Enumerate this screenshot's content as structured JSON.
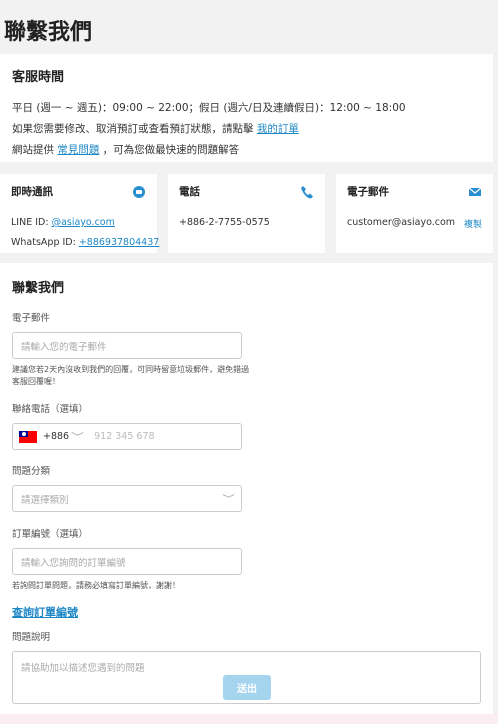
{
  "page_title": "聯繫我們",
  "service_hours": {
    "heading": "客服時間",
    "line1": "平日 (週一 ~ 週五)：09:00 ~ 22:00；假日 (週六/日及連續假日)：12:00 ~ 18:00",
    "line2_prefix": "如果您需要修改、取消預訂或查看預訂狀態，請點擊 ",
    "line2_link": "我的訂單",
    "line3_prefix": "網站提供 ",
    "line3_link": "常見問題",
    "line3_suffix": " ，可為您做最快速的問題解答"
  },
  "chat": {
    "heading": "即時通訊",
    "icon": "chat-icon",
    "line_label": "LINE ID: ",
    "line_value": "@asiayo.com",
    "whatsapp_label": "WhatsApp ID: ",
    "whatsapp_value": "+886937804437"
  },
  "phone": {
    "heading": "電話",
    "icon": "phone-icon",
    "value": "+886-2-7755-0575"
  },
  "email": {
    "heading": "電子郵件",
    "icon": "mail-icon",
    "value": "customer@asiayo.com",
    "copy_label": "複製"
  },
  "form": {
    "heading": "聯繫我們",
    "email_label": "電子郵件",
    "email_placeholder": "請輸入您的電子郵件",
    "email_hint": "建議您若2天內沒收到我們的回覆，可同時留意垃圾郵件，避免錯過客服回覆喔！",
    "phone_label": "聯絡電話（選填）",
    "phone_country_code": "+886",
    "phone_placeholder": "912 345 678",
    "category_label": "問題分類",
    "category_placeholder": "請選擇類別",
    "order_label": "訂單編號（選填）",
    "order_placeholder": "請輸入您詢問的訂單編號",
    "order_hint": "若詢問訂單問題，請務必填寫訂單編號，謝謝！",
    "query_order_link": "查詢訂單編號",
    "desc_label": "問題說明",
    "desc_placeholder": "請協助加以描述您遇到的問題",
    "submit_label": "送出"
  },
  "colors": {
    "link": "#1e88c7",
    "submit_button": "#a5d4ef",
    "background": "#f2f2f2"
  }
}
